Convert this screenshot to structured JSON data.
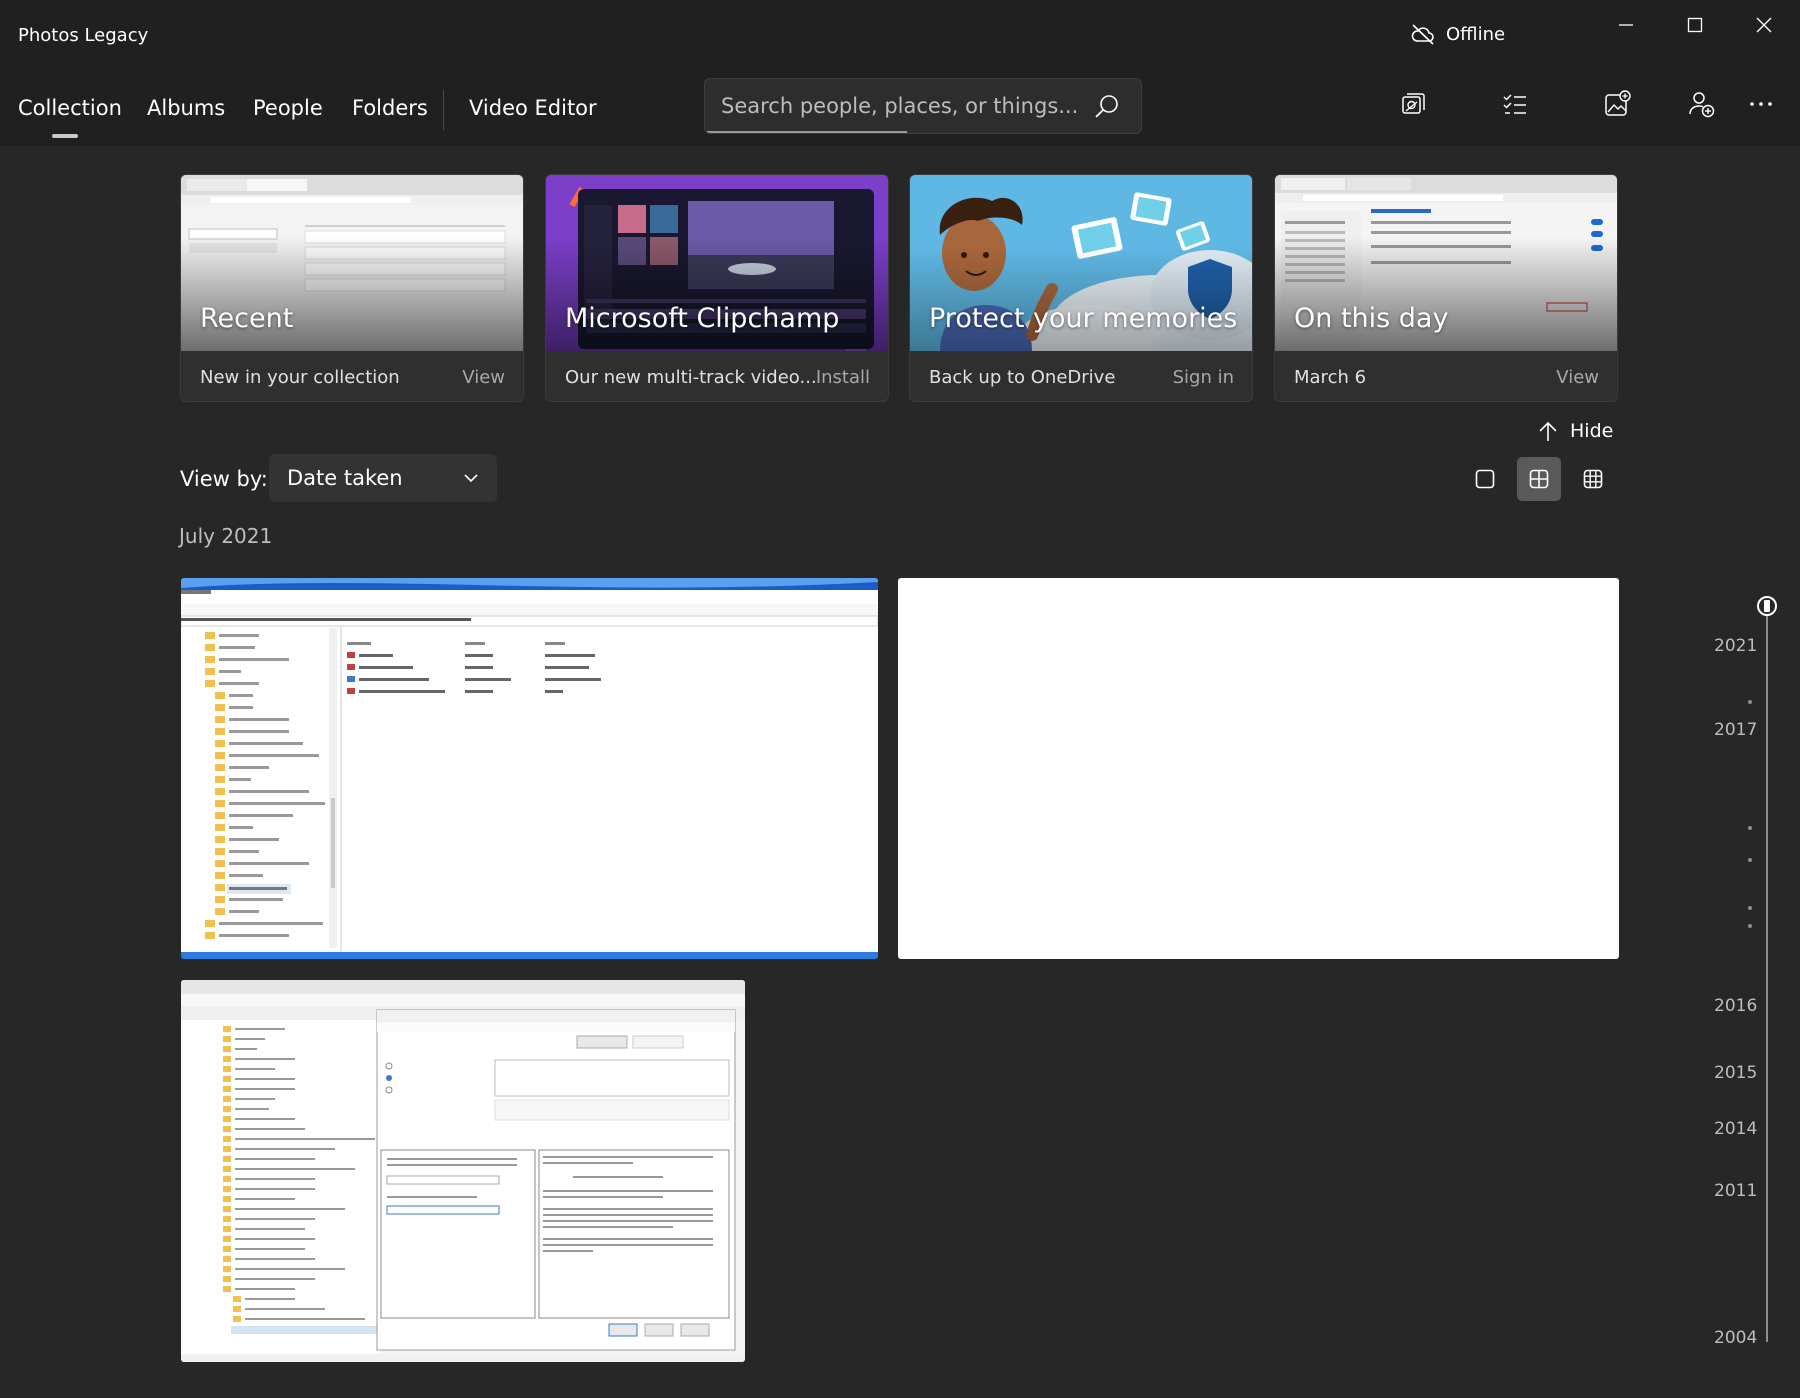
{
  "window": {
    "title": "Photos Legacy",
    "status": "Offline"
  },
  "nav": {
    "tabs": [
      "Collection",
      "Albums",
      "People",
      "Folders",
      "Video Editor"
    ],
    "active_tab": "Collection"
  },
  "search": {
    "placeholder": "Search people, places, or things..."
  },
  "toolbar": {
    "icons": [
      "import-icon",
      "select-icon",
      "new-item-icon",
      "account-icon",
      "more-icon"
    ]
  },
  "cards": [
    {
      "title": "Recent",
      "subtitle": "New in your collection",
      "action": "View"
    },
    {
      "title": "Microsoft Clipchamp",
      "subtitle": "Our new multi-track video...",
      "action": "Install"
    },
    {
      "title": "Protect your memories",
      "subtitle": "Back up to OneDrive",
      "action": "Sign in"
    },
    {
      "title": "On this day",
      "subtitle": "March 6",
      "action": "View"
    }
  ],
  "hide_label": "Hide",
  "view_by": {
    "label": "View by:",
    "value": "Date taken"
  },
  "zoom_levels": {
    "selected": "medium"
  },
  "month_heading": "July 2021",
  "timeline": {
    "years": [
      "2021",
      "2017",
      "2016",
      "2015",
      "2014",
      "2011",
      "2004"
    ]
  },
  "colors": {
    "background": "#272727",
    "chrome": "#202020",
    "card": "#2f2f2f"
  }
}
